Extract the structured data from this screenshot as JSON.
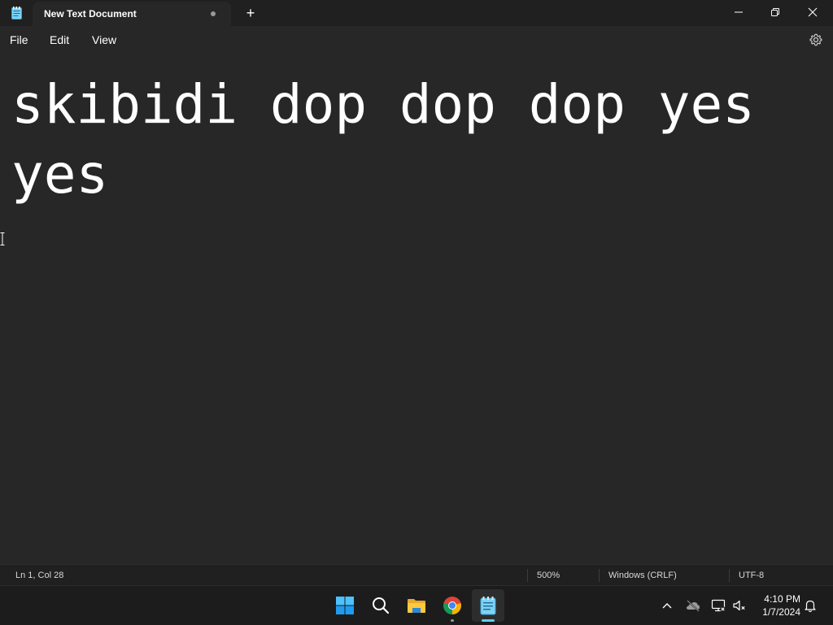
{
  "window": {
    "tab_title": "New Text Document",
    "new_tab_label": "+"
  },
  "menu": {
    "file": "File",
    "edit": "Edit",
    "view": "View"
  },
  "editor": {
    "content": "skibidi dop dop dop yes yes"
  },
  "status": {
    "position": "Ln 1, Col 28",
    "zoom": "500%",
    "line_ending": "Windows (CRLF)",
    "encoding": "UTF-8"
  },
  "taskbar": {
    "apps": [
      "start-icon",
      "search-icon",
      "file-explorer-icon",
      "chrome-icon",
      "notepad-icon"
    ],
    "time": "4:10 PM",
    "date": "1/7/2024"
  },
  "colors": {
    "background": "#272727",
    "titlebar": "#202020",
    "accent": "#60cdff"
  }
}
